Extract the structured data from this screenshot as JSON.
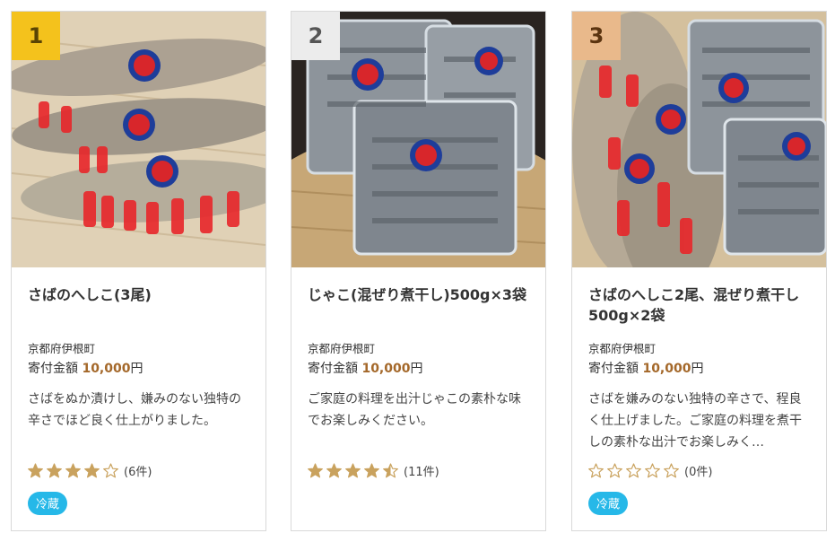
{
  "colors": {
    "rank_1": "#f4c21c",
    "rank_2": "#ececec",
    "rank_3": "#e9b98b",
    "price": "#a4682a",
    "star": "#c9a25e",
    "tag": "#26b8e8"
  },
  "cards": [
    {
      "rank": "1",
      "title": "さばのへしこ(3尾)",
      "region": "京都府伊根町",
      "amount_label": "寄付金額",
      "amount_value": "10,000",
      "amount_unit": "円",
      "description": "さばをぬか漬けし、嫌みのない独特の辛さでほど良く仕上がりました。",
      "rating": 4,
      "review_count": "(6件)",
      "tag": "冷蔵"
    },
    {
      "rank": "2",
      "title": "じゃこ(混ぜり煮干し)500g×3袋",
      "region": "京都府伊根町",
      "amount_label": "寄付金額",
      "amount_value": "10,000",
      "amount_unit": "円",
      "description": "ご家庭の料理を出汁じゃこの素朴な味でお楽しみください。",
      "rating": 4.5,
      "review_count": "(11件)",
      "tag": ""
    },
    {
      "rank": "3",
      "title": "さばのへしこ2尾、混ぜり煮干し500g×2袋",
      "region": "京都府伊根町",
      "amount_label": "寄付金額",
      "amount_value": "10,000",
      "amount_unit": "円",
      "description": "さばを嫌みのない独特の辛さで、程良く仕上げました。ご家庭の料理を煮干しの素朴な出汁でお楽しみく…",
      "rating": 0,
      "review_count": "(0件)",
      "tag": "冷蔵"
    }
  ]
}
